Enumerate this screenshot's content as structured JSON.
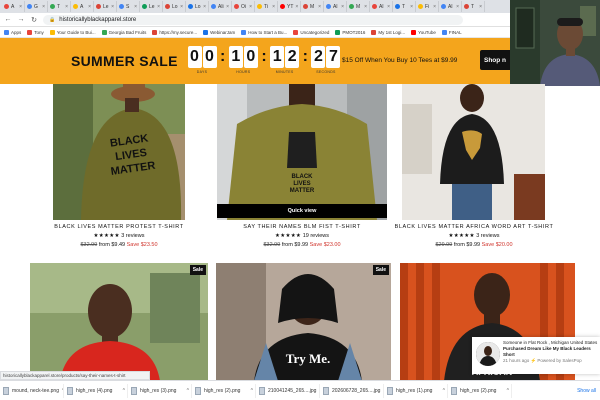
{
  "browser": {
    "tabs": [
      {
        "label": "A",
        "color": "#e8453c"
      },
      {
        "label": "G",
        "color": "#4285f4"
      },
      {
        "label": "T",
        "color": "#34a853"
      },
      {
        "label": "A",
        "color": "#fbbc05"
      },
      {
        "label": "Le",
        "color": "#db4437"
      },
      {
        "label": "S",
        "color": "#4285f4"
      },
      {
        "label": "Le",
        "color": "#0f9d58"
      },
      {
        "label": "Lo",
        "color": "#db4437"
      },
      {
        "label": "Lo",
        "color": "#1a73e8"
      },
      {
        "label": "Ali",
        "color": "#4285f4"
      },
      {
        "label": "Oi",
        "color": "#e8453c"
      },
      {
        "label": "Ti",
        "color": "#fbbc05"
      },
      {
        "label": "YT",
        "color": "#ff0000"
      },
      {
        "label": "M",
        "color": "#db4437"
      },
      {
        "label": "Al",
        "color": "#4285f4"
      },
      {
        "label": "M",
        "color": "#34a853"
      },
      {
        "label": "Al",
        "color": "#e8453c"
      },
      {
        "label": "T",
        "color": "#1a73e8"
      },
      {
        "label": "Fi",
        "color": "#fbbc05"
      },
      {
        "label": "Al",
        "color": "#4285f4"
      },
      {
        "label": "T",
        "color": "#db4437"
      }
    ],
    "url": "historicallyblackapparel.store",
    "bookmarks": [
      {
        "label": "Apps",
        "color": "#4285f4"
      },
      {
        "label": "Tony",
        "color": "#e8453c"
      },
      {
        "label": "Your Guide to Bui...",
        "color": "#fbbc05"
      },
      {
        "label": "Georgia Bad Fruits",
        "color": "#34a853"
      },
      {
        "label": "https://my.secure...",
        "color": "#db4437"
      },
      {
        "label": "WebinarJam",
        "color": "#1a73e8"
      },
      {
        "label": "How to Start a Bu...",
        "color": "#4285f4"
      },
      {
        "label": "Uncategorized",
        "color": "#e8453c"
      },
      {
        "label": "PMOT2016",
        "color": "#0f9d58"
      },
      {
        "label": "My 1st Logi...",
        "color": "#db4437"
      },
      {
        "label": "YouTube",
        "color": "#ff0000"
      },
      {
        "label": "FINAL",
        "color": "#4285f4"
      }
    ]
  },
  "promo": {
    "title": "SUMMER SALE",
    "timer": [
      {
        "digits": [
          "0",
          "0"
        ],
        "label": "DAYS"
      },
      {
        "digits": [
          "1",
          "0"
        ],
        "label": "HOURS"
      },
      {
        "digits": [
          "1",
          "2"
        ],
        "label": "MINUTES"
      },
      {
        "digits": [
          "2",
          "7"
        ],
        "label": "SECONDS"
      }
    ],
    "offer": "$15 Off When You Buy 10 Tees at $9.99",
    "shop_label": "Shop n"
  },
  "products": [
    {
      "name": "BLACK LIVES MATTER PROTEST T-SHIRT",
      "stars": "★★★★★",
      "reviews": "3 reviews",
      "old_price": "$32.99",
      "price": "from $9.49",
      "save": "Save $23.50",
      "shirt_text": "BLACK LIVES MATTER",
      "shirt_color": "#6f6b2a"
    },
    {
      "name": "SAY THEIR NAMES BLM FIST T-SHIRT",
      "stars": "★★★★★",
      "reviews": "19 reviews",
      "old_price": "$32.99",
      "price": "from $9.99",
      "save": "Save $23.00",
      "shirt_text": "BLACK LIVES MATTER",
      "shirt_color": "#8a8335",
      "quickview": "Quick view"
    },
    {
      "name": "BLACK LIVES MATTER AFRICA WORD ART T-SHIRT",
      "stars": "★★★★★",
      "reviews": "3 reviews",
      "old_price": "$29.99",
      "price": "from $9.99",
      "save": "Save $20.00",
      "shirt_color": "#1c1c1c"
    }
  ],
  "row2": [
    {
      "sale": "Sale",
      "shirt_color": "#d8261e"
    },
    {
      "sale": "Sale",
      "shirt_text": "Try Me.",
      "shirt_color": "#141414"
    },
    {
      "shirt_text": "AFRICAN",
      "shirt_color": "#202020"
    }
  ],
  "status_url": "historicallyblackapparel.store/products/say-their-names-t-shirt",
  "salespop": {
    "line1": "Someone in Flat Rock , Michigan United States",
    "line2": "Purchased Dream Like My Black Leaders Short",
    "line3": "21 hours ago ⚡ Powered by SalesPop"
  },
  "downloads": [
    {
      "name": "mound, neck-tee.png"
    },
    {
      "name": "high_res (4).png"
    },
    {
      "name": "high_res (3).png"
    },
    {
      "name": "high_res (2).png"
    },
    {
      "name": "210041245_265....jpg"
    },
    {
      "name": "202606728_265....jpg"
    },
    {
      "name": "high_res (1).png"
    },
    {
      "name": "high_res (2).png"
    }
  ],
  "downloads_show_all": "Show all"
}
